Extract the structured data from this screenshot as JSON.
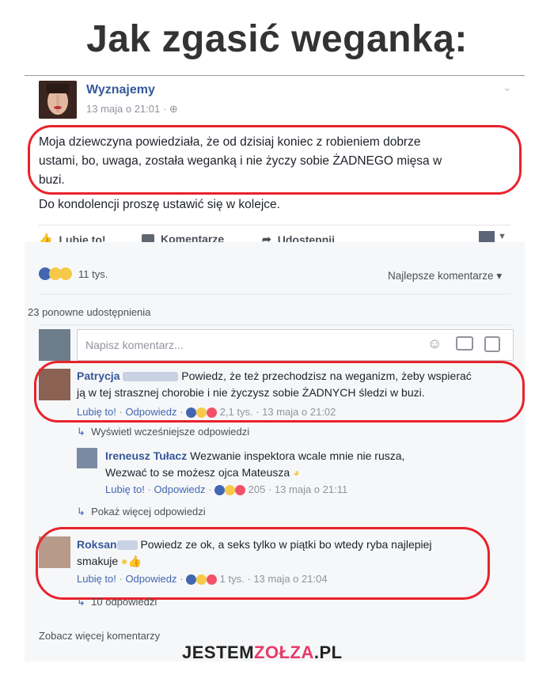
{
  "headline": "Jak zgasić weganką:",
  "post": {
    "page_name": "Wyznajemy",
    "date": "13 maja o 21:01",
    "text_lines": [
      "Moja dziewczyna powiedziała, że od dzisiaj koniec z robieniem dobrze",
      "ustami, bo, uwaga, została weganką i nie życzy sobie ŻADNEGO mięsa w",
      "buzi."
    ],
    "text2": "Do kondolencji proszę ustawić się w kolejce."
  },
  "actions": {
    "like": "Lubię to!",
    "comment": "Komentarze",
    "share": "Udostępnij"
  },
  "reactions_count": "11 tys.",
  "sort_label": "Najlepsze komentarze",
  "shares": "23 ponowne udostępnienia",
  "comment_placeholder": "Napisz komentarz...",
  "comments": [
    {
      "author": "Patrycja",
      "text_lines": [
        "Powiedz, że też przechodzisz na weganizm, żeby wspierać",
        "ją w tej strasznej chorobie i nie życzysz sobie ŻADNYCH śledzi w buzi."
      ],
      "like": "Lubię to!",
      "reply": "Odpowiedz",
      "count": "2,1 tys.",
      "date": "13 maja o 21:02"
    },
    {
      "author": "Roksan",
      "text_lines": [
        "Powiedz ze ok, a seks tylko w piątki bo wtedy ryba najlepiej",
        "smakuje"
      ],
      "like": "Lubię to!",
      "reply": "Odpowiedz",
      "count": "1 tys.",
      "date": "13 maja o 21:04"
    }
  ],
  "earlier_replies": "Wyświetl wcześniejsze odpowiedzi",
  "reply": {
    "author": "Ireneusz Tułacz",
    "text_lines": [
      "Wezwanie inspektora wcale mnie nie rusza,",
      "Wezwać to se możesz ojca Mateusza"
    ],
    "like": "Lubię to!",
    "reply": "Odpowiedz",
    "count": "205",
    "date": "13 maja o 21:11"
  },
  "more_replies": "Pokaż więcej odpowiedzi",
  "replies_count": "10 odpowiedzi",
  "see_more": "Zobacz więcej komentarzy",
  "watermark": {
    "a": "JESTEM",
    "b": "ZOŁZA",
    "c": ".PL"
  },
  "colors": {
    "fb_blue": "#365899",
    "marker_red": "#e8232b",
    "bg_comments": "#f6f7f9"
  }
}
